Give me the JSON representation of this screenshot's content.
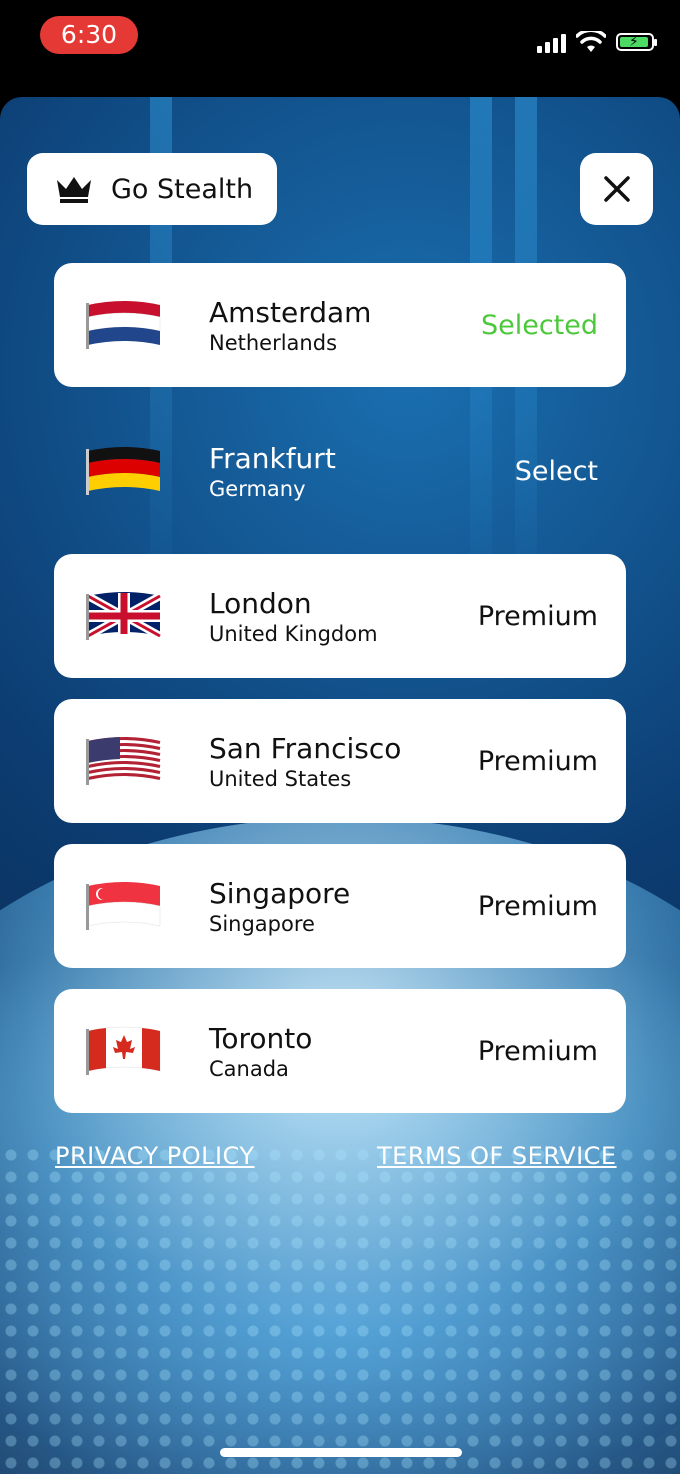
{
  "status_bar": {
    "time": "6:30"
  },
  "header": {
    "stealth_label": "Go Stealth"
  },
  "servers": [
    {
      "city": "Amsterdam",
      "country": "Netherlands",
      "status": "Selected",
      "flag": "netherlands-flag"
    },
    {
      "city": "Frankfurt",
      "country": "Germany",
      "status": "Select",
      "flag": "germany-flag"
    },
    {
      "city": "London",
      "country": "United Kingdom",
      "status": "Premium",
      "flag": "uk-flag"
    },
    {
      "city": "San Francisco",
      "country": "United States",
      "status": "Premium",
      "flag": "us-flag"
    },
    {
      "city": "Singapore",
      "country": "Singapore",
      "status": "Premium",
      "flag": "singapore-flag"
    },
    {
      "city": "Toronto",
      "country": "Canada",
      "status": "Premium",
      "flag": "canada-flag"
    }
  ],
  "footer": {
    "privacy": "PRIVACY POLICY",
    "terms": "TERMS OF SERVICE"
  },
  "colors": {
    "selected": "#4cc93a",
    "time_pill": "#e53935"
  }
}
